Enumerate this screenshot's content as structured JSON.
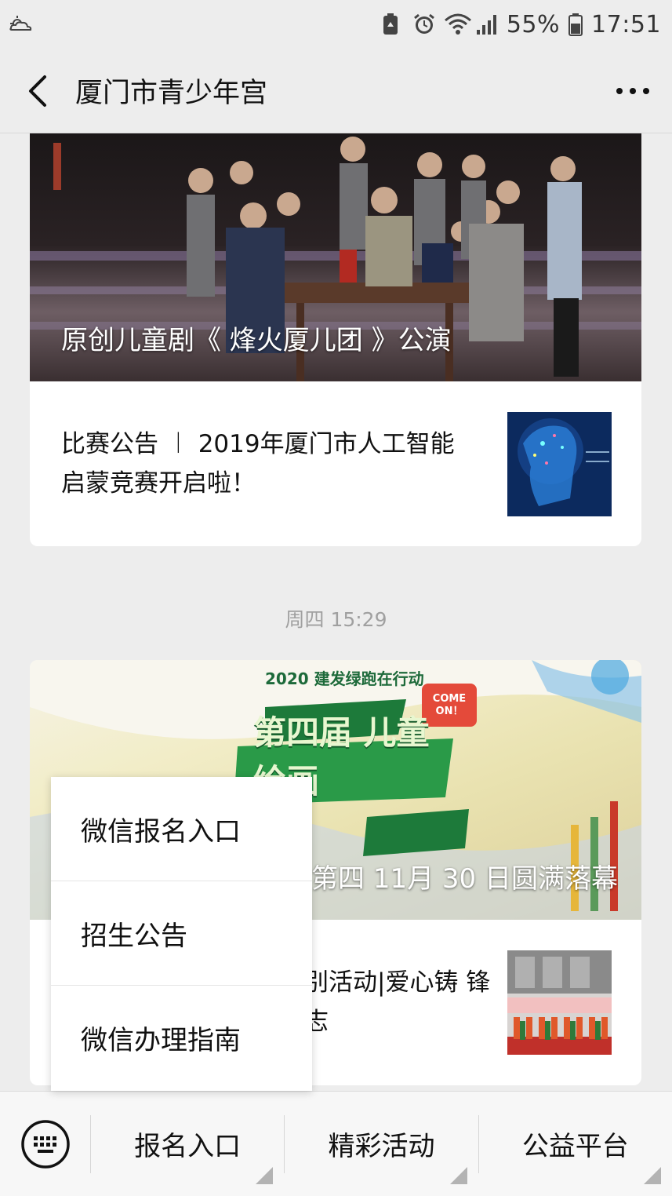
{
  "status_bar": {
    "battery_percent": "55%",
    "time": "17:51"
  },
  "header": {
    "title": "厦门市青少年宫"
  },
  "feed": {
    "card1": {
      "cover_title": "原创儿童剧《 烽火厦儿团 》公演",
      "sub_title": "比赛公告 ︱ 2019年厦门市人工智能启蒙竞赛开启啦！"
    },
    "time_label": "周四 15:29",
    "card2": {
      "cover_title": "20 建发绿跑在行动第四 11月 30 日圆满落幕",
      "sub_title": "别活动|爱心铸 锋志",
      "poster_year_text": "2020 建发绿跑在行动",
      "poster_main_text": "第四届 儿童绘画",
      "poster_badge": "COME ON！"
    }
  },
  "popup_menu": {
    "items": [
      "微信报名入口",
      "招生公告",
      "微信办理指南"
    ]
  },
  "bottom_menu": {
    "tabs": [
      "报名入口",
      "精彩活动",
      "公益平台"
    ]
  },
  "colors": {
    "background": "#ededed",
    "card": "#ffffff",
    "time_label": "#a0a0a0"
  }
}
